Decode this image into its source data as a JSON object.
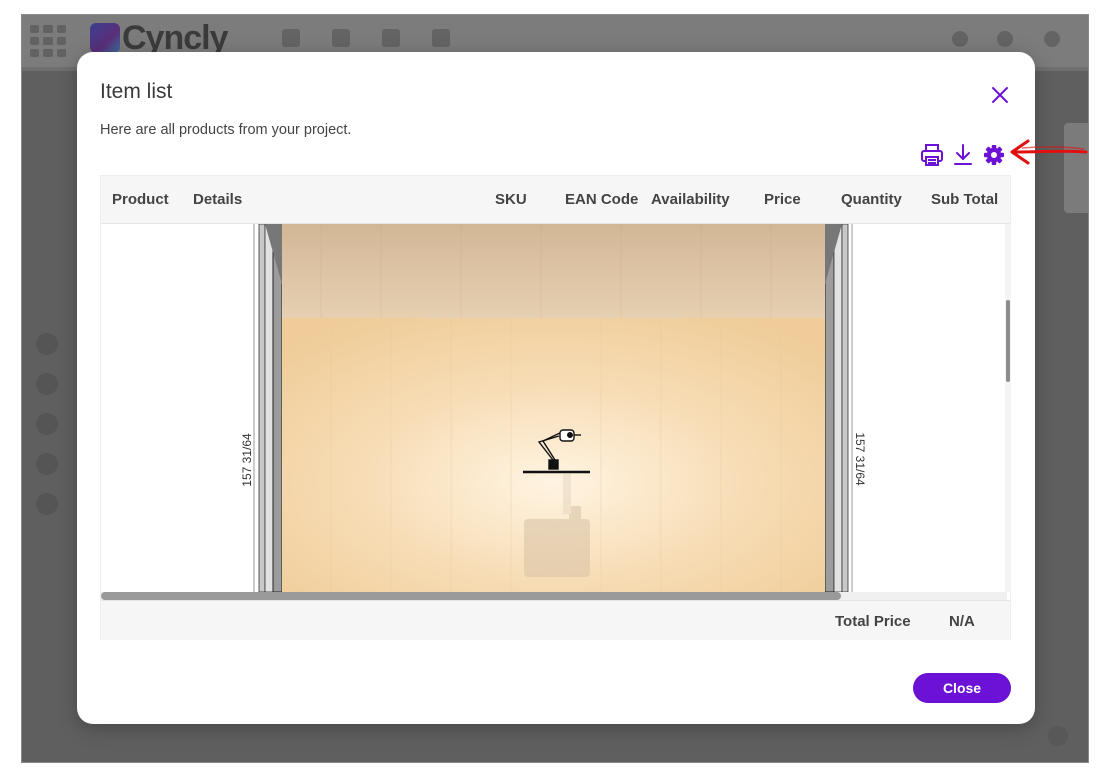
{
  "background_app": {
    "logo_text": "Cyncly"
  },
  "modal": {
    "title": "Item list",
    "subtitle": "Here are all products from your project.",
    "toolbar": {
      "icons": [
        "print-icon",
        "download-icon",
        "settings-icon"
      ]
    },
    "table": {
      "columns": [
        "Product",
        "Details",
        "SKU",
        "EAN Code",
        "Availability",
        "Price",
        "Quantity",
        "Sub Total"
      ],
      "drawing": {
        "dimension_left": "157 31/64",
        "dimension_right": "157 31/64"
      },
      "footer": {
        "total_label": "Total Price",
        "total_value": "N/A"
      }
    },
    "close_button_label": "Close"
  },
  "colors": {
    "accent": "#6b12d6",
    "annotation_arrow": "#e01010",
    "overlay": "#6f6f6f"
  }
}
